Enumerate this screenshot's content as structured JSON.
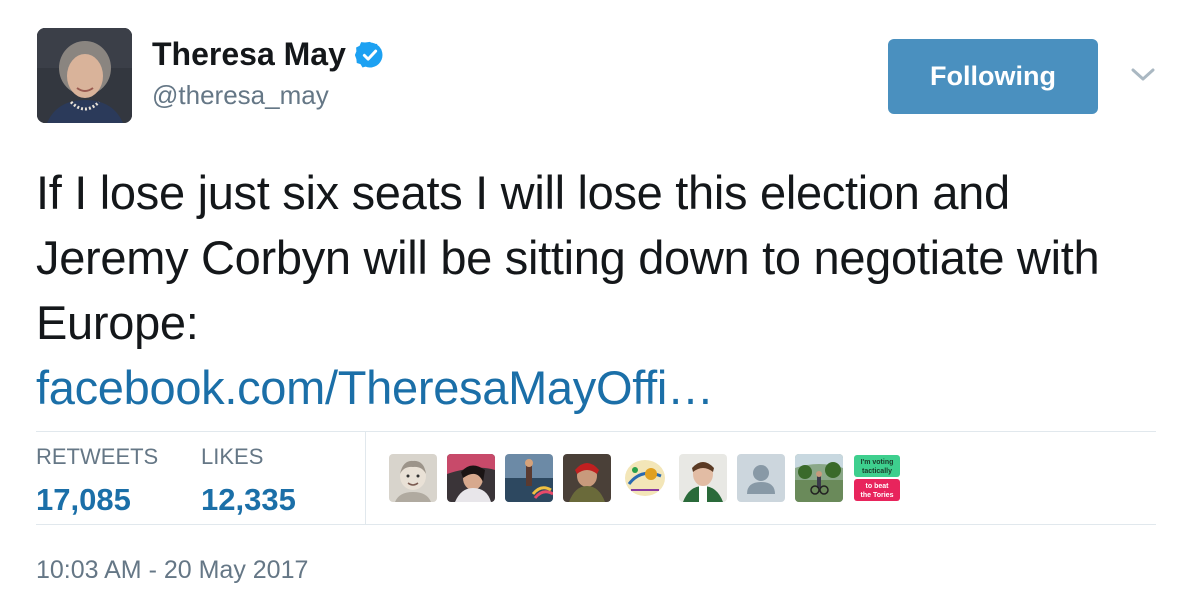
{
  "author": {
    "name": "Theresa May",
    "handle": "@theresa_may",
    "verified": true
  },
  "follow_button": {
    "label": "Following",
    "color": "#4a90bf"
  },
  "tweet": {
    "text": "If I lose just six seats I will lose this election and Jeremy Corbyn will be sitting down to negotiate with Europe:",
    "link": "facebook.com/TheresaMayOffi…"
  },
  "stats": {
    "retweets_label": "RETWEETS",
    "retweets_value": "17,085",
    "likes_label": "LIKES",
    "likes_value": "12,335"
  },
  "liker_avatars": [
    {
      "name": "liker-avatar-1"
    },
    {
      "name": "liker-avatar-2"
    },
    {
      "name": "liker-avatar-3"
    },
    {
      "name": "liker-avatar-4"
    },
    {
      "name": "liker-avatar-5"
    },
    {
      "name": "liker-avatar-6"
    },
    {
      "name": "liker-avatar-7-default"
    },
    {
      "name": "liker-avatar-8"
    },
    {
      "name": "liker-avatar-9",
      "line1": "I'm voting",
      "line2": "tactically",
      "line3": "to beat",
      "line4": "the Tories"
    }
  ],
  "timestamp": "10:03 AM - 20 May 2017",
  "colors": {
    "link": "#1b6fa8",
    "muted": "#657786",
    "text": "#14171a",
    "verified": "#1da1f2"
  },
  "icons": {
    "verified": "verified-badge-icon",
    "more": "chevron-down-icon"
  }
}
